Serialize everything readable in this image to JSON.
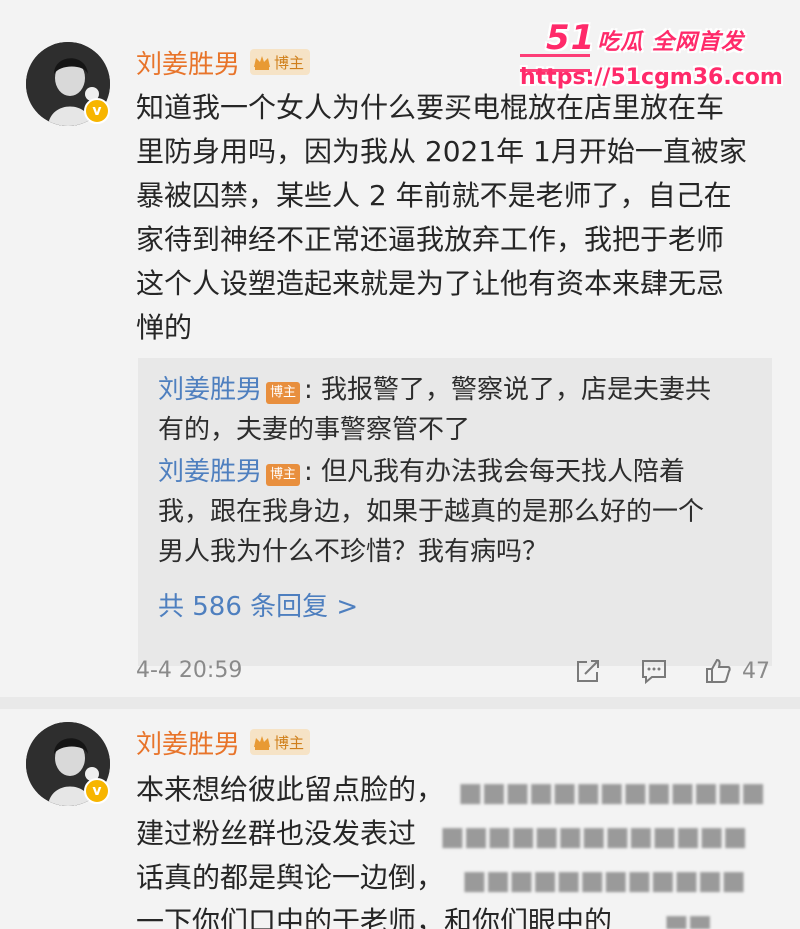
{
  "watermark": {
    "brand": "51",
    "brand_sub": "吃瓜 全网首发",
    "url": "https://51cgm36.com"
  },
  "posts": [
    {
      "author": "刘姜胜男",
      "badge": "博主",
      "verified_icon": "v",
      "lines": [
        "知道我一个女人为什么要买电棍放在店里放在车",
        "里防身用吗，因为我从 2021年 1月开始一直被家",
        "暴被囚禁，某些人 2 年前就不是老师了，自己在",
        "家待到神经不正常还逼我放弃工作，我把于老师",
        "这个人设塑造起来就是为了让他有资本来肆无忌",
        "惮的"
      ],
      "replies": [
        {
          "author": "刘姜胜男",
          "badge": "博主",
          "lines": [
            ": 我报警了，警察说了，店是夫妻共",
            "有的，夫妻的事警察管不了"
          ]
        },
        {
          "author": "刘姜胜男",
          "badge": "博主",
          "lines": [
            ": 但凡我有办法我会每天找人陪着",
            "我，跟在我身边，如果于越真的是那么好的一个",
            "男人我为什么不珍惜？我有病吗？"
          ]
        }
      ],
      "more_replies": "共 586 条回复 >",
      "timestamp": "4-4 20:59",
      "actions": {
        "share_icon": "share-icon",
        "comment_icon": "comment-icon",
        "like_icon": "thumbs-up-icon",
        "like_count": "47"
      }
    },
    {
      "author": "刘姜胜男",
      "badge": "博主",
      "verified_icon": "v",
      "lines": [
        "本来想给彼此留点脸的，",
        "建过粉丝群也没发表过",
        "话真的都是舆论一边倒，",
        "一下你们口中的于老师，和你们眼中的"
      ]
    }
  ]
}
